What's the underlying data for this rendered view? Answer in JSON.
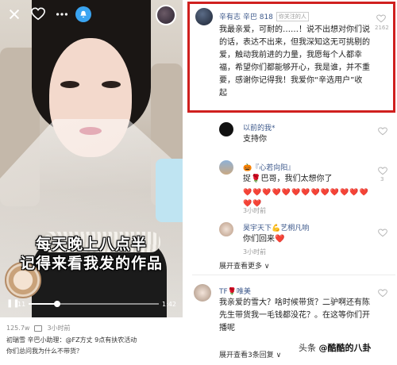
{
  "left": {
    "caption_line1": "每天晚上八点半",
    "caption_line2": "记得来看我发的作品",
    "video": {
      "time_start": "11",
      "time_end": "1:42",
      "progress": 0.22
    },
    "meta": {
      "views": "125.7w",
      "time": "3小时前"
    },
    "post_line1": "初瑞雪 辛巴小助理：@FZ方丈 9点有扶农活动",
    "post_line2": "你们总问我为什么不带货？"
  },
  "comments": {
    "main": {
      "name": "辛有志 辛巴 818",
      "tag": "你关注的人",
      "text": "我最亲爱，可耐的……！说不出想对你们说的话，表达不出来，但我深知这无可挑剔的爱，触动我前进的力量，我愿每个人都幸福，希望你们都能够开心，我是谁，并不重要，感谢你记得我！我爱你“辛选用户”收起",
      "likes": "2162"
    },
    "replies": [
      {
        "name": "以前的我*",
        "text": "支持你",
        "time": "",
        "likes": ""
      },
      {
        "name": "🎃『心若向阳』",
        "text": "捉🌹巴哥，我们太想你了",
        "hearts": "❤️❤️❤️❤️❤️❤️❤️❤️❤️❤️❤️❤️❤️❤️❤️",
        "time": "3小时前",
        "likes": "3"
      },
      {
        "name": "昊宇天下💪艺桐凡响",
        "text": "你们回来❤️",
        "time": "3小时前",
        "likes": ""
      }
    ],
    "expand1": "展开查看更多 ∨",
    "second": {
      "name": "TF🌹唯美",
      "text": "我亲爱的雪大？啥时候带货？二驴啊还有陈先生带货我一毛钱都没花？。在这等你们开播呢",
      "expand": "展开查看3条回复 ∨"
    }
  },
  "watermark": {
    "prefix": "头条",
    "handle": "@酷酷的八卦"
  },
  "colors": {
    "highlight": "#d0201f",
    "heart": "#e8573c",
    "name": "#3e5a8c"
  }
}
